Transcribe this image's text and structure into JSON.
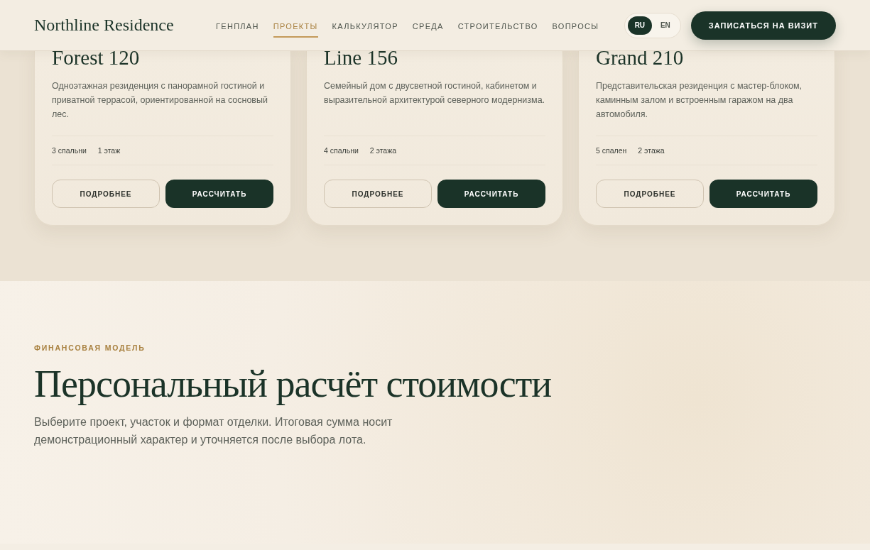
{
  "header": {
    "logo": "Northline Residence",
    "nav": [
      {
        "label": "ГЕНПЛАН",
        "selected": false
      },
      {
        "label": "ПРОЕКТЫ",
        "selected": true
      },
      {
        "label": "КАЛЬКУЛЯТОР",
        "selected": false
      },
      {
        "label": "СРЕДА",
        "selected": false
      },
      {
        "label": "СТРОИТЕЛЬСТВО",
        "selected": false
      },
      {
        "label": "ВОПРОСЫ",
        "selected": false
      }
    ],
    "languages": [
      {
        "label": "RU",
        "selected": true
      },
      {
        "label": "EN",
        "selected": false
      }
    ],
    "cta": "ЗАПИСАТЬСЯ НА ВИЗИТ"
  },
  "projects": [
    {
      "title": "Forest 120",
      "description": "Одноэтажная резиденция с панорамной гостиной и приватной террасой, ориентированной на сосновый лес.",
      "specs": [
        "3 спальни",
        "1 этаж"
      ],
      "details_button": "ПОДРОБНЕЕ",
      "calc_button": "РАССЧИТАТЬ"
    },
    {
      "title": "Line 156",
      "description": "Семейный дом с двусветной гостиной, кабинетом и выразительной архитектурой северного модернизма.",
      "specs": [
        "4 спальни",
        "2 этажа"
      ],
      "details_button": "ПОДРОБНЕЕ",
      "calc_button": "РАССЧИТАТЬ"
    },
    {
      "title": "Grand 210",
      "description": "Представительская резиденция с мастер-блоком, каминным залом и встроенным гаражом на два автомобиля.",
      "specs": [
        "5 спален",
        "2 этажа"
      ],
      "details_button": "ПОДРОБНЕЕ",
      "calc_button": "РАССЧИТАТЬ"
    }
  ],
  "finance": {
    "eyebrow": "ФИНАНСОВАЯ МОДЕЛЬ",
    "heading": "Персональный расчёт стоимости",
    "lead": "Выберите проект, участок и формат отделки. Итоговая сумма носит демонстрационный характер и уточняется после выбора лота."
  }
}
